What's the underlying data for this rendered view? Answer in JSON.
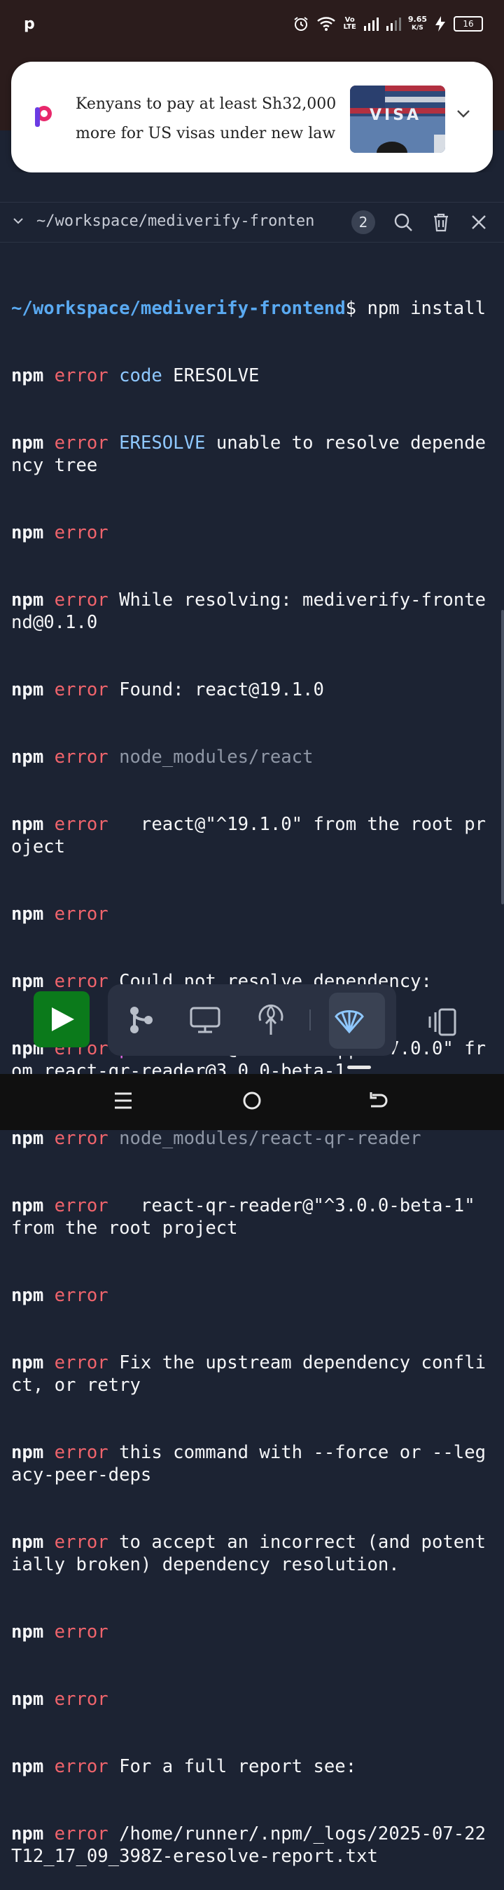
{
  "status_bar": {
    "app_icon": "p",
    "icons": [
      "alarm-icon",
      "wifi-icon",
      "volte-icon",
      "signal-icon",
      "signal-icon",
      "charging-icon"
    ],
    "volte": "Vo\nLTE",
    "net_speed_value": "9.65",
    "net_speed_unit": "K/S",
    "battery": "16"
  },
  "notification": {
    "headline_line1": "Kenyans to pay at least Sh32,000",
    "headline_line2": "more for US visas under new law",
    "thumb_text": "VISA"
  },
  "terminal_tab": {
    "title": "~/workspace/mediverify-fronten",
    "count": "2"
  },
  "terminal": {
    "cwd": "~/workspace/mediverify-frontend",
    "prompt": "$ npm install",
    "npm": "npm",
    "error": "error",
    "lines": {
      "l1a": "code",
      "l1b": " ERESOLVE",
      "l2a": "ERESOLVE",
      "l2b": " unable to resolve dependency tree",
      "l4": " While resolving: mediverify-frontend@0.1.0",
      "l5": " Found: react@19.1.0",
      "l6": "node_modules/react",
      "l7": "   react@\"^19.1.0\" from the root project",
      "l9": " Could not resolve dependency:",
      "l10a": "peer",
      "l10b": " react@\"^16.8.0 || ^17.0.0\" from react-qr-reader@3.0.0-beta-1",
      "l11": "node_modules/react-qr-reader",
      "l12": "   react-qr-reader@\"^3.0.0-beta-1\" from the root project",
      "l14": " Fix the upstream dependency conflict, or retry",
      "l15": " this command with --force or --legacy-peer-deps",
      "l16": " to accept an incorrect (and potentially broken) dependency resolution.",
      "l19": " For a full report see:",
      "l20": " /home/runner/.npm/_logs/2025-07-22T12_17_09_398Z-eresolve-report.txt"
    }
  },
  "toolbar": {
    "buttons": [
      "run-button",
      "git-icon",
      "monitor-icon",
      "antenna-icon",
      "shell-icon",
      "split-panel-icon"
    ],
    "active": "shell-icon"
  },
  "navbar": {
    "items": [
      "menu-icon",
      "home-icon",
      "back-icon"
    ]
  },
  "colors": {
    "background": "#1c2333",
    "cwd": "#5aaaf2",
    "error": "#f0646c",
    "peer": "#e066e6",
    "run_button": "#0b7a1b"
  }
}
